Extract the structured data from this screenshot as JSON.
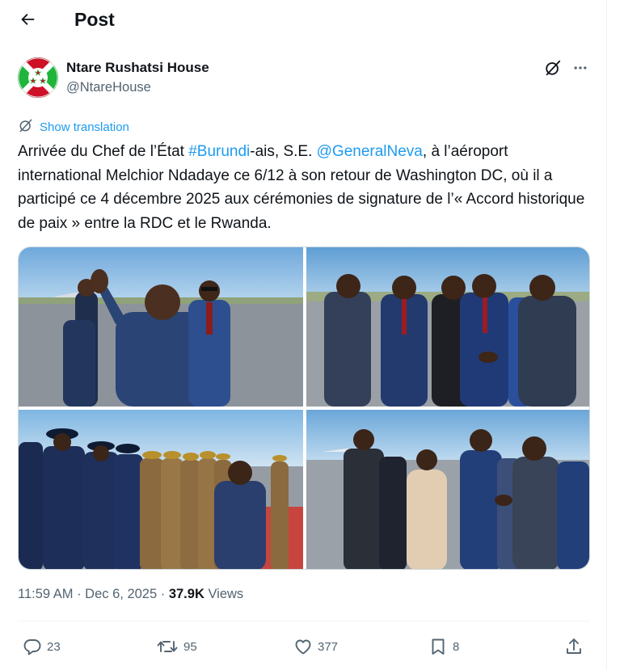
{
  "header": {
    "title": "Post",
    "back_icon": "arrow-left-icon"
  },
  "author": {
    "name": "Ntare Rushatsi House",
    "handle": "@NtareHouse",
    "avatar_icon": "burundi-flag-emblem",
    "avatar_colors": {
      "red": "#ce1126",
      "green": "#1eb53a",
      "white": "#ffffff"
    }
  },
  "top_actions": {
    "grok_icon": "grok-slash-circle-icon",
    "more_icon": "more-dots-icon"
  },
  "translation": {
    "label": "Show translation",
    "icon": "translate-slash-icon"
  },
  "tweet": {
    "part1": "Arrivée du Chef de l’État ",
    "hashtag": "#Burundi",
    "part2": "-ais, S.E. ",
    "mention": "@GeneralNeva",
    "part3": ", à l’aéroport international Melchior Ndadaye ce 6/12 à son retour de Washington DC, où il a participé ce 4 décembre 2025 aux cérémonies de signature de l’« Accord historique de paix » entre la RDC et le Rwanda.",
    "link_color": "#1d9bf0"
  },
  "media": {
    "photo_count": 4
  },
  "meta": {
    "time": "11:59 AM",
    "separator": " · ",
    "date": "Dec 6, 2025",
    "separator2": " · ",
    "views_count": "37.9K",
    "views_label": " Views"
  },
  "actions": {
    "reply_count": "23",
    "repost_count": "95",
    "like_count": "377",
    "bookmark_count": "8",
    "reply_icon": "reply-bubble-icon",
    "repost_icon": "repost-arrows-icon",
    "like_icon": "heart-icon",
    "bookmark_icon": "bookmark-icon",
    "share_icon": "share-upload-icon"
  },
  "colors": {
    "text_primary": "#0f1419",
    "text_secondary": "#536471",
    "accent": "#1d9bf0",
    "border": "#cfd9de"
  }
}
